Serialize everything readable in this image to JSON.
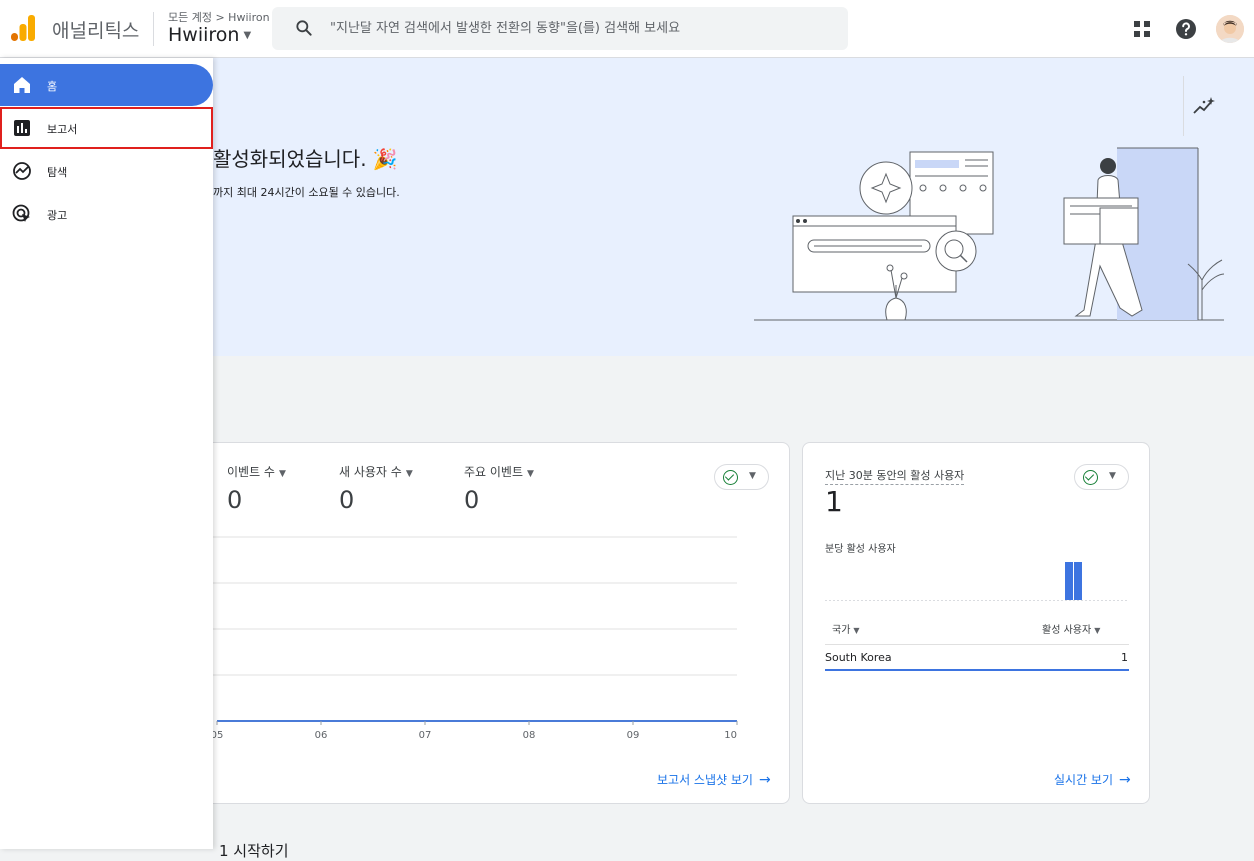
{
  "header": {
    "app_name": "애널리틱스",
    "breadcrumb": "모든 계정 > Hwiiron",
    "account_name": "Hwiiron",
    "search_placeholder": "\"지난달 자연 검색에서 발생한 전환의 동향\"을(를) 검색해 보세요",
    "icons": [
      "apps-icon",
      "help-icon",
      "avatar"
    ]
  },
  "sidebar": {
    "items": [
      {
        "label": "홈",
        "icon": "home-icon",
        "active": true
      },
      {
        "label": "보고서",
        "icon": "reports-icon",
        "highlighted": true
      },
      {
        "label": "탐색",
        "icon": "explore-icon"
      },
      {
        "label": "광고",
        "icon": "advertising-icon"
      }
    ]
  },
  "hero": {
    "title": "활성화되었습니다.",
    "title_emoji": "🎉",
    "subtitle": "까지 최대 24시간이 소요될 수 있습니다."
  },
  "main_card": {
    "metrics": [
      {
        "label": "이벤트 수",
        "value": "0"
      },
      {
        "label": "새 사용자 수",
        "value": "0"
      },
      {
        "label": "주요 이벤트",
        "value": "0"
      }
    ],
    "link": "보고서 스냅샷 보기"
  },
  "chart_data": {
    "type": "line",
    "x": [
      "05",
      "06",
      "07",
      "08",
      "09",
      "10"
    ],
    "series": [
      {
        "values": [
          0,
          0,
          0,
          0,
          0,
          0
        ]
      }
    ],
    "grid": true,
    "color": "#4a7bd8"
  },
  "realtime_card": {
    "title": "지난 30분 동안의 활성 사용자",
    "value": "1",
    "subtitle": "분당 활성 사용자",
    "col_country": "국가",
    "col_users": "활성 사용자",
    "rows": [
      {
        "country": "South Korea",
        "users": "1"
      }
    ],
    "link": "실시간 보기"
  },
  "section": {
    "title": "1 시작하기"
  },
  "colors": {
    "accent": "#1a73e8",
    "sidebar_active": "#3d74e0",
    "hero_bg": "#e8f0fe",
    "highlight_outline": "#e0201d"
  }
}
